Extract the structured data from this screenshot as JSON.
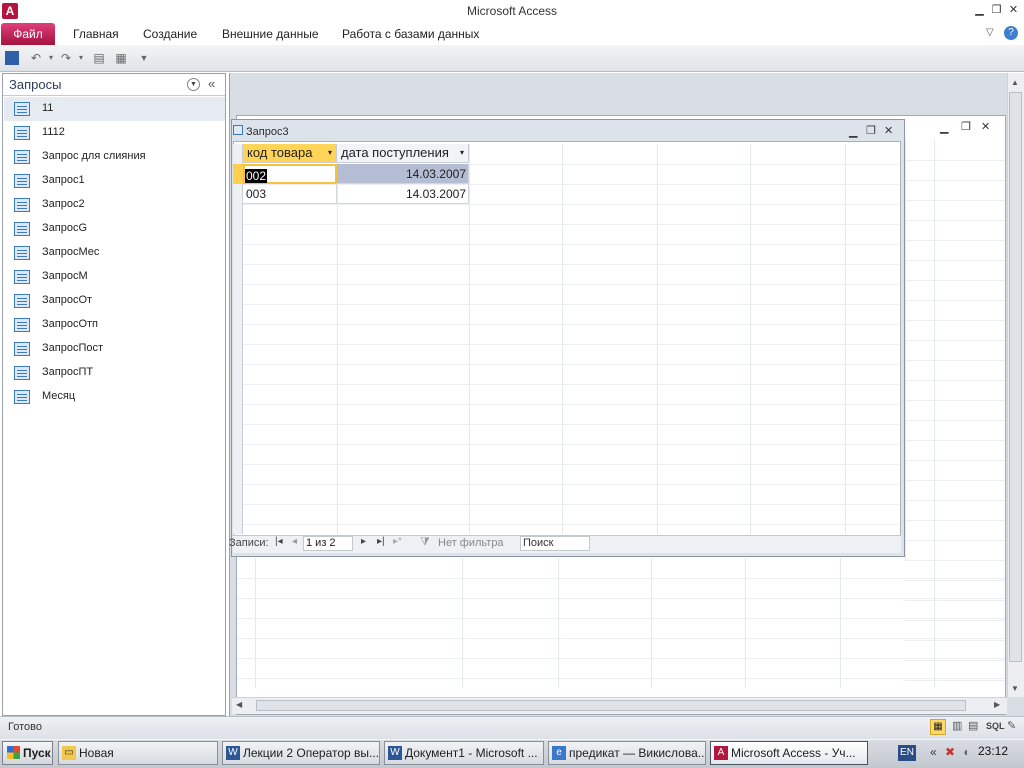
{
  "window": {
    "title": "Microsoft Access",
    "app_icon": "A"
  },
  "ribbon": {
    "tabs": [
      "Файл",
      "Главная",
      "Создание",
      "Внешние данные",
      "Работа с базами данных"
    ]
  },
  "nav_pane": {
    "title": "Запросы",
    "items": [
      "11",
      "1112",
      "Запрос для слияния",
      "Запрос1",
      "Запрос2",
      "ЗапросG",
      "ЗапросМес",
      "ЗапросМ",
      "ЗапросОт",
      "ЗапросОтп",
      "ЗапросПост",
      "ЗапросПТ",
      "Месяц"
    ]
  },
  "query_window": {
    "title": "Запрос3",
    "columns": [
      "код товара",
      "дата поступления"
    ],
    "rows": [
      [
        "002",
        "14.03.2007"
      ],
      [
        "003",
        "14.03.2007"
      ]
    ],
    "record_nav": {
      "label": "Записи:",
      "position": "1 из 2",
      "filter": "Нет фильтра",
      "search_placeholder": "Поиск"
    }
  },
  "status_bar": {
    "text": "Готово",
    "sql": "SQL"
  },
  "taskbar": {
    "start": "Пуск",
    "buttons": [
      "Новая",
      "Лекции 2 Оператор вы...",
      "Документ1 - Microsoft ...",
      "предикат — Викислова...",
      "Microsoft Access - Уч..."
    ],
    "lang": "EN",
    "clock": "23:12"
  },
  "colors": {
    "file_tab": "#b3153c",
    "selected_cell": "#ffffff",
    "header_selected": "#ffd457",
    "selected_row_bg": "#b4bdd4"
  }
}
